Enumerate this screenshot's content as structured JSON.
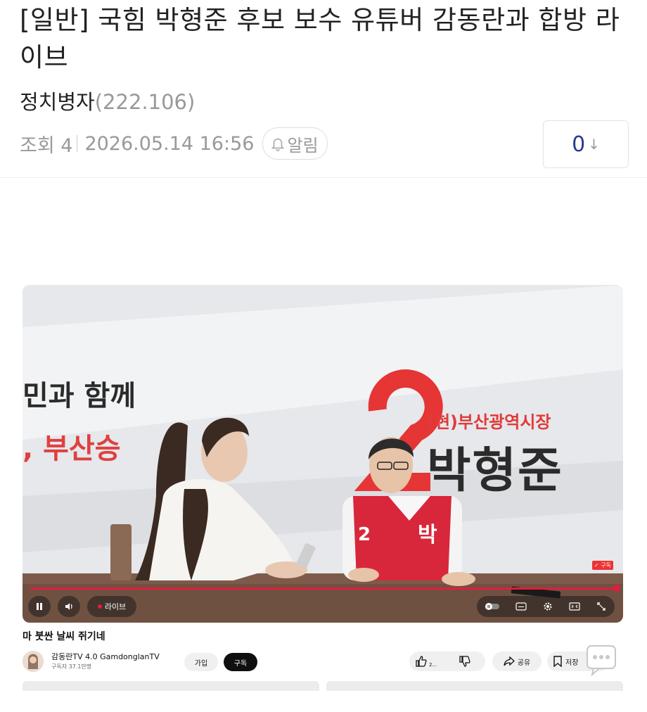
{
  "post": {
    "title": "[일반] 국힘 박형준 후보 보수 유튜버 감동란과 합방 라이브",
    "author": "정치병자",
    "author_count": "(222.106)",
    "views": "조회 4",
    "datetime": "2026.05.14 16:56",
    "alarm_label": "알림",
    "recommend_count": "0",
    "recommend_icon": "↓"
  },
  "video": {
    "banner_left_line1": "민과 함께",
    "banner_left_line2": ", 부산승",
    "banner_sub": "(현)부산광역시장",
    "banner_name": "박형준",
    "vest_number": "2",
    "vest_text": "박",
    "subscribe_badge": "✓ 구독",
    "live_label": "라이브",
    "progress": 1.0,
    "title": "마 붓싼 날씨 쥐기네",
    "channel_name": "감동란TV 4.0 GamdonglanTV",
    "channel_subs": "구독자 37.1만명",
    "join_label": "가입",
    "subscribe_label": "구독",
    "share_label": "공유",
    "save_label": "저장",
    "like_count": "2..."
  },
  "colors": {
    "accent_red": "#e31c3d",
    "recommend_blue": "#2a3a8c",
    "muted": "#999999"
  }
}
